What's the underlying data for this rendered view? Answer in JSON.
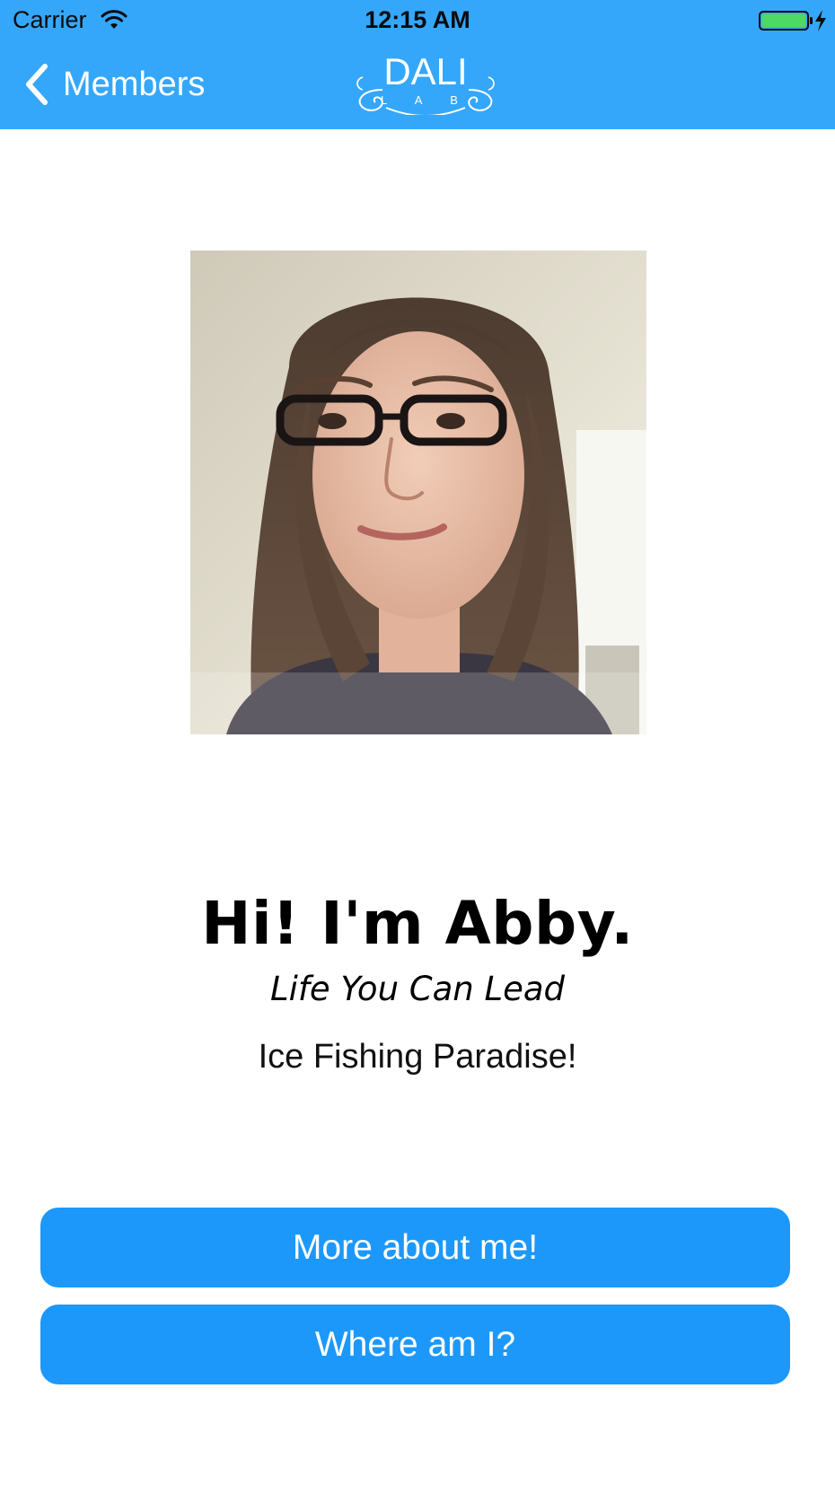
{
  "status_bar": {
    "carrier": "Carrier",
    "time": "12:15 AM",
    "battery_color": "#4cd964"
  },
  "nav": {
    "back_label": "Members",
    "background_color": "#35a7fb",
    "logo": {
      "top_text": "DALI",
      "bottom_text": "L A B"
    }
  },
  "profile": {
    "photo_icon": "profile-photo",
    "greeting": "Hi! I'm Abby.",
    "tagline": "Life You Can Lead",
    "subtitle": "Ice Fishing Paradise!"
  },
  "actions": {
    "more_label": "More about me!",
    "where_label": "Where am I?",
    "button_color": "#1c98fb"
  }
}
